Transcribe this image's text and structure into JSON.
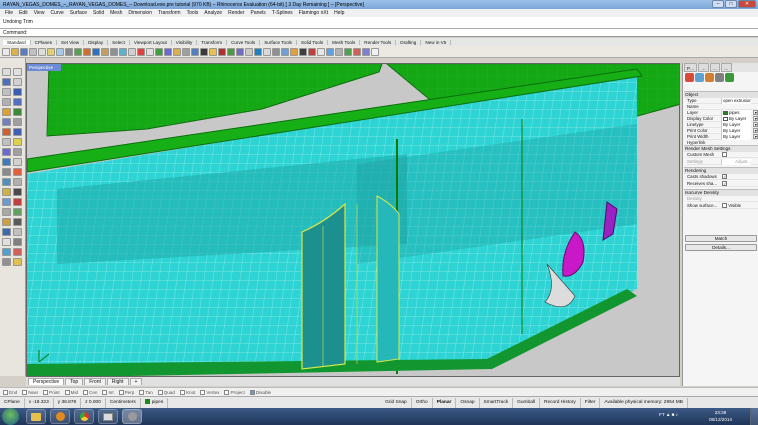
{
  "window": {
    "title": "RAYAN_VEGAS_DOMES_–_RAYAN_VEGAS_DOMES_– Download.exe.pre tutorial (970 KB) – Rhinoceros Evaluation (64-bit) [ 3 Day Remaining ] – [Perspective]",
    "buttons": {
      "minimize": "–",
      "maximize": "□",
      "close": "✕"
    }
  },
  "menu": [
    "File",
    "Edit",
    "View",
    "Curve",
    "Surface",
    "Solid",
    "Mesh",
    "Dimension",
    "Transform",
    "Tools",
    "Analyze",
    "Render",
    "Panels",
    "T-Splines",
    "Flamingo nXt",
    "Help"
  ],
  "command_history": "Undoing Trim",
  "command_prompt": "Command:",
  "toolbar_tabs": [
    {
      "label": "Standard",
      "active": true
    },
    {
      "label": "CPlanes"
    },
    {
      "label": "Set View"
    },
    {
      "label": "Display"
    },
    {
      "label": "Select"
    },
    {
      "label": "Viewport Layout"
    },
    {
      "label": "Visibility"
    },
    {
      "label": "Transform"
    },
    {
      "label": "Curve Tools"
    },
    {
      "label": "Surface Tools"
    },
    {
      "label": "Solid Tools"
    },
    {
      "label": "Mesh Tools"
    },
    {
      "label": "Render Tools"
    },
    {
      "label": "Drafting"
    },
    {
      "label": "New in V5"
    }
  ],
  "toolbar_icon_colors": [
    "#e9e9e9",
    "#d9b24a",
    "#5a7fc0",
    "#c0c0c0",
    "#dcdcdc",
    "#e0d070",
    "#a8c8e8",
    "#8a8a8a",
    "#58a058",
    "#d07030",
    "#3070c0",
    "#c0a060",
    "#909090",
    "#60b0d0",
    "#d0d0d0",
    "#e04040",
    "#e0e0e0",
    "#40a040",
    "#6a6ad0",
    "#d8b050",
    "#a0a0a0",
    "#5080c0",
    "#3a3a3a",
    "#e8c050",
    "#b03030",
    "#4a9a4a",
    "#7070c0",
    "#c8c8c8",
    "#2080c0",
    "#d8d8d8",
    "#909090",
    "#70a0d0",
    "#e0a040",
    "#404040",
    "#c04040",
    "#e6e6e6",
    "#60a0e0",
    "#b0b0b0",
    "#50a050",
    "#d06060",
    "#8080d0",
    "#f0f0f0"
  ],
  "viewport": {
    "label": "Perspective",
    "tabs": [
      {
        "label": "Perspective",
        "active": true
      },
      {
        "label": "Top"
      },
      {
        "label": "Front"
      },
      {
        "label": "Right"
      },
      {
        "label": "+"
      }
    ],
    "colors": {
      "background": "#c8c8c8",
      "glass": "#2ed4d4",
      "glass_dark": "#1fa8a8",
      "frame_green": "#14a814",
      "frame_dark": "#0b6e0b",
      "highlight": "#d6e84a",
      "magenta": "#c818c8"
    }
  },
  "osnaps": [
    {
      "label": "End"
    },
    {
      "label": "Near"
    },
    {
      "label": "Point"
    },
    {
      "label": "Mid"
    },
    {
      "label": "Cen"
    },
    {
      "label": "Int"
    },
    {
      "label": "Perp"
    },
    {
      "label": "Tan"
    },
    {
      "label": "Quad"
    },
    {
      "label": "Knot"
    },
    {
      "label": "Vertex"
    },
    {
      "label": "Project"
    },
    {
      "label": "Disable",
      "on": true
    }
  ],
  "status": {
    "cplane": "CPlane",
    "x": "x -18.323",
    "y": "y 38.879",
    "z": "z 0.000",
    "units": "Centimeters",
    "layer": "pipes",
    "grid_snap": "Grid Snap",
    "ortho": "Ortho",
    "planar": "Planar",
    "osnap": "Osnap",
    "smarttrack": "SmartTrack",
    "gumball": "Gumball",
    "record_history": "Record History",
    "filter": "Filter",
    "memory": "Available physical memory: 2954 MB"
  },
  "properties": {
    "tabs": [
      "P…",
      "…",
      "…",
      "…"
    ],
    "section_object": "Object",
    "rows": [
      {
        "k": "Type",
        "v": "open extrusion"
      },
      {
        "k": "Name",
        "v": ""
      },
      {
        "k": "Layer",
        "v": "pipes",
        "swatch": "#1a8a1a",
        "dd": true
      },
      {
        "k": "Display Color",
        "v": "By Layer",
        "swatch": "#ffffff",
        "dd": true
      },
      {
        "k": "Linetype",
        "v": "By Layer",
        "dd": true
      },
      {
        "k": "Print Color",
        "v": "By Layer",
        "dd": true
      },
      {
        "k": "Print Width",
        "v": "By Layer",
        "dd": true
      },
      {
        "k": "Hyperlink",
        "v": ""
      }
    ],
    "section_mesh": "Render Mesh Settings",
    "custom_mesh": "Custom Mesh",
    "settings": "Settings",
    "adjust": "Adjust...",
    "section_render": "Rendering",
    "casts_shadows": "Casts shadows",
    "receives_shadows": "Receives sha...",
    "section_iso": "Isocurve Density",
    "density": "Density",
    "show_surface": "Show surface...",
    "visible": "Visible",
    "match_btn": "Match",
    "details_btn": "Details..."
  },
  "taskbar": {
    "time": "23:38",
    "date": "08/12/2014",
    "tray": "FT ▲ ■ ♪"
  }
}
